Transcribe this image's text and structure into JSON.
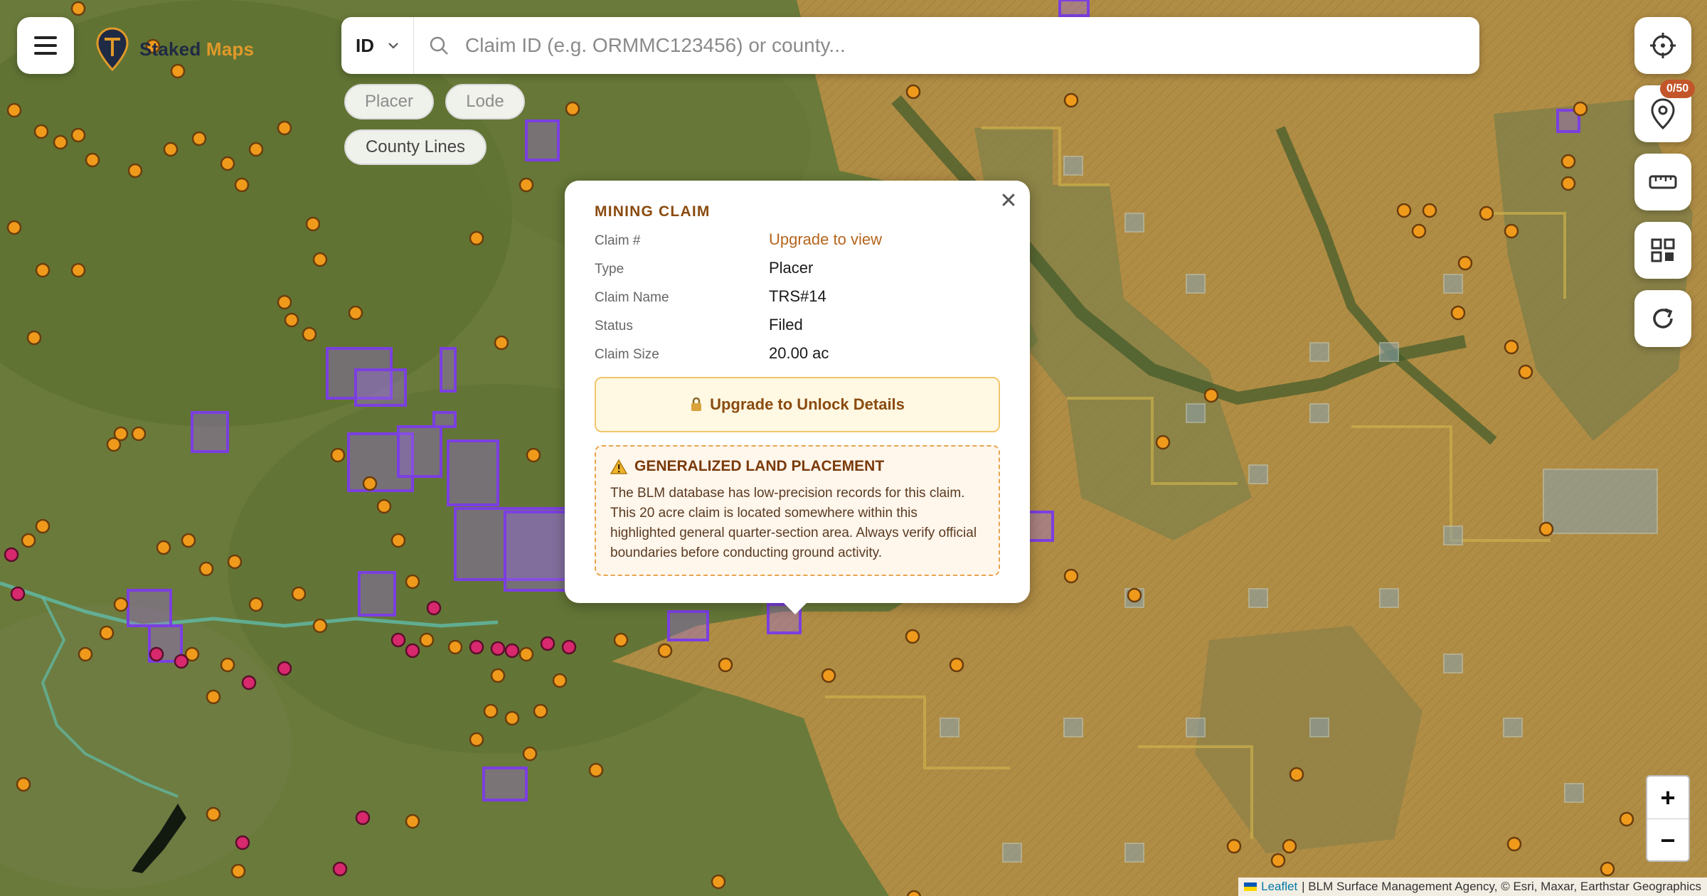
{
  "brand": {
    "name_primary": "Staked",
    "name_accent": "Maps"
  },
  "search": {
    "state": "ID",
    "placeholder": "Claim ID (e.g. ORMMC123456) or county..."
  },
  "filters": {
    "placer": "Placer",
    "lode": "Lode",
    "county_lines": "County Lines"
  },
  "colors": {
    "claim_purple": "#7b3fe0",
    "marker_orange": "#f09a1c",
    "marker_pink": "#d8286e",
    "brand_accent": "#e09a2a",
    "popup_accent": "#b5651d"
  },
  "right_controls": {
    "pins_badge": "0/50",
    "icons": [
      "crosshair-icon",
      "map-pin-icon",
      "ruler-icon",
      "grid-icon",
      "refresh-icon"
    ]
  },
  "zoom": {
    "in": "+",
    "out": "−"
  },
  "attribution": {
    "leaflet": "Leaflet",
    "sources": "| BLM Surface Management Agency, © Esri, Maxar, Earthstar Geographics"
  },
  "popup": {
    "title": "MINING CLAIM",
    "fields": [
      {
        "label": "Claim #",
        "value": "Upgrade to view"
      },
      {
        "label": "Type",
        "value": "Placer"
      },
      {
        "label": "Claim Name",
        "value": "TRS#14"
      },
      {
        "label": "Status",
        "value": "Filed"
      },
      {
        "label": "Claim Size",
        "value": "20.00 ac"
      }
    ],
    "upgrade_label": "Upgrade to Unlock Details",
    "warning_title": "GENERALIZED LAND PLACEMENT",
    "warning_text": "The BLM database has low-precision records for this claim. This 20 acre claim is located somewhere within this highlighted general quarter-section area. Always verify official boundaries before conducting ground activity."
  }
}
